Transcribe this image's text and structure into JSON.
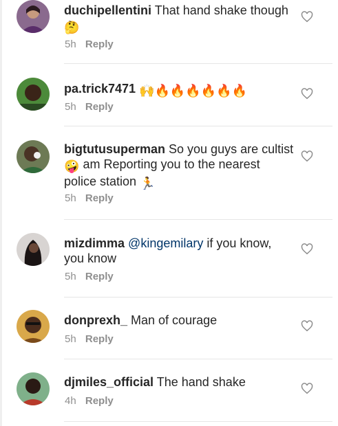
{
  "comments": [
    {
      "username": "duchipellentini",
      "text": "That hand shake though",
      "mention": "",
      "emojis": "🤔",
      "time": "5h",
      "reply": "Reply"
    },
    {
      "username": "pa.trick7471",
      "text": "",
      "mention": "",
      "emojis": "🙌🔥🔥🔥🔥🔥🔥",
      "time": "5h",
      "reply": "Reply"
    },
    {
      "username": "bigtutusuperman",
      "text": "So you guys are cultist",
      "text2": "am Reporting you to the nearest police station",
      "mention": "",
      "emojis": "🤪",
      "emojis2": "🏃",
      "time": "5h",
      "reply": "Reply"
    },
    {
      "username": "mizdimma",
      "text": "if you know, you know",
      "mention": "@kingemilary",
      "emojis": "",
      "time": "5h",
      "reply": "Reply"
    },
    {
      "username": "donprexh_",
      "text": "Man of courage",
      "mention": "",
      "emojis": "",
      "time": "5h",
      "reply": "Reply"
    },
    {
      "username": "djmiles_official",
      "text": "The hand shake",
      "mention": "",
      "emojis": "",
      "time": "4h",
      "reply": "Reply"
    }
  ],
  "icons": {
    "like": "heart-outline-icon"
  },
  "colors": {
    "text": "#262626",
    "meta": "#8e8e8e",
    "mention": "#003569",
    "divider": "#e6e6e6"
  }
}
